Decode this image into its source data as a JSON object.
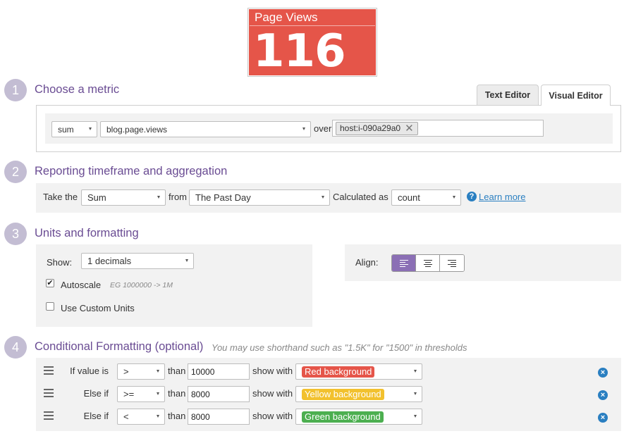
{
  "widget": {
    "title": "Page Views",
    "value": "116",
    "background": "#e55549"
  },
  "steps": [
    {
      "number": "1",
      "title": "Choose a metric"
    },
    {
      "number": "2",
      "title": "Reporting timeframe and aggregation"
    },
    {
      "number": "3",
      "title": "Units and formatting"
    },
    {
      "number": "4",
      "title": "Conditional Formatting (optional)",
      "hint": "You may use shorthand such as \"1.5K\" for \"1500\" in thresholds"
    }
  ],
  "metric": {
    "tabs": [
      {
        "label": "Text Editor",
        "active": false
      },
      {
        "label": "Visual Editor",
        "active": true
      }
    ],
    "aggregator": "sum",
    "metric_name": "blog.page.views",
    "over_label": "over",
    "tags": [
      "host:i-090a29a0"
    ],
    "tag_remove_glyph": "✕"
  },
  "timeframe": {
    "take_the_label": "Take the",
    "aggregation": "Sum",
    "from_label": "from",
    "timeframe": "The Past Day",
    "calculated_as_label": "Calculated as",
    "calculation": "count",
    "help_glyph": "?",
    "learn_more": "Learn more"
  },
  "units": {
    "show_label": "Show:",
    "decimals": "1 decimals",
    "autoscale_label": "Autoscale",
    "autoscale_checked": true,
    "autoscale_example": "EG 1000000 -> 1M",
    "custom_units_label": "Use Custom Units",
    "custom_units_checked": false,
    "align_label": "Align:",
    "align_options": [
      {
        "icon": "align-left-icon",
        "active": true
      },
      {
        "icon": "align-center-icon",
        "active": false
      },
      {
        "icon": "align-right-icon",
        "active": false
      }
    ],
    "accent": "#8b6fb5"
  },
  "conditional": {
    "than_label": "than",
    "show_with_label": "show with",
    "remove_glyph": "×",
    "rules": [
      {
        "prefix": "If value is",
        "operator": ">",
        "threshold": "10000",
        "style": "Red background",
        "color": "#e55549"
      },
      {
        "prefix": "Else if",
        "operator": ">=",
        "threshold": "8000",
        "style": "Yellow background",
        "color": "#f2c12e"
      },
      {
        "prefix": "Else if",
        "operator": "<",
        "threshold": "8000",
        "style": "Green background",
        "color": "#4caf50"
      }
    ]
  },
  "checkmark_glyph": "✔"
}
